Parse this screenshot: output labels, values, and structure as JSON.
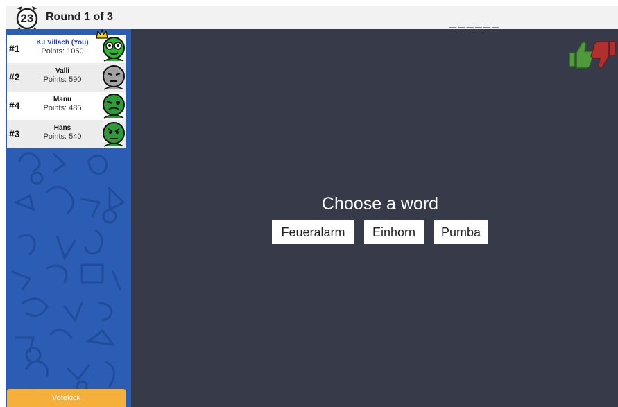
{
  "header": {
    "timer": "23",
    "round_text": "Round 1 of 3",
    "word_hint": "______"
  },
  "players": [
    {
      "rank": "#1",
      "name": "KJ Villach (You)",
      "points": "Points: 1050",
      "is_you": true,
      "has_crown": true,
      "avatar_color": "#2fb52f"
    },
    {
      "rank": "#2",
      "name": "Valli",
      "points": "Points: 590",
      "is_you": false,
      "has_crown": false,
      "avatar_color": "#a3a3a3"
    },
    {
      "rank": "#4",
      "name": "Manu",
      "points": "Points: 485",
      "is_you": false,
      "has_crown": false,
      "avatar_color": "#2f9a3a"
    },
    {
      "rank": "#3",
      "name": "Hans",
      "points": "Points: 540",
      "is_you": false,
      "has_crown": false,
      "avatar_color": "#2f9a3a"
    }
  ],
  "votekick": {
    "label": "Votekick"
  },
  "canvas": {
    "prompt": "Choose a word",
    "words": [
      "Feueralarm",
      "Einhorn",
      "Pumba"
    ]
  },
  "icons": {
    "like": "thumbs-up-icon",
    "dislike": "thumbs-down-icon",
    "clock": "alarm-clock-icon",
    "crown": "crown-icon"
  },
  "colors": {
    "panel_blue": "#2a5db3",
    "canvas_bg": "#373a48",
    "votekick_bg": "#f5b03c",
    "you_name": "#1a3fd6",
    "like_green": "#4f9a3a",
    "dislike_red": "#b03030"
  }
}
